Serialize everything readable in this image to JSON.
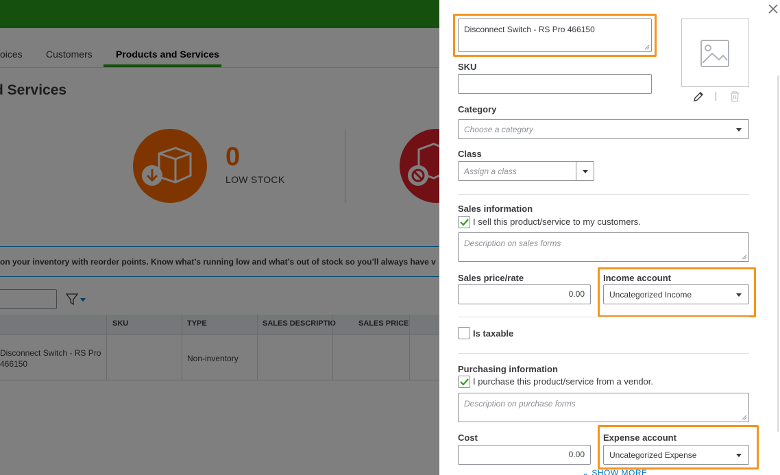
{
  "background": {
    "tabs": [
      "oices",
      "Customers",
      "Products and Services"
    ],
    "active_tab": "Products and Services",
    "page_title": "d Services",
    "low_stock": {
      "count": "0",
      "label": "LOW STOCK"
    },
    "banner_text": "on your inventory with reorder points. Know what’s running low and what’s out of stock so you’ll always have v",
    "table": {
      "headers": [
        "SKU",
        "TYPE",
        "SALES DESCRIPTIO",
        "SALES PRICE"
      ],
      "row": {
        "name_line1": "Disconnect Switch - RS Pro",
        "name_line2": "466150",
        "type": "Non-inventory"
      }
    }
  },
  "panel": {
    "name_value": "Disconnect Switch - RS Pro 466150",
    "sku_label": "SKU",
    "category_label": "Category",
    "category_placeholder": "Choose a category",
    "class_label": "Class",
    "class_placeholder": "Assign a class",
    "sales": {
      "section_label": "Sales information",
      "checkbox_text": "I sell this product/service to my customers.",
      "description_placeholder": "Description on sales forms",
      "price_label": "Sales price/rate",
      "price_value": "0.00",
      "income_label": "Income account",
      "income_value": "Uncategorized Income"
    },
    "taxable_label": "Is taxable",
    "purchasing": {
      "section_label": "Purchasing information",
      "checkbox_text": "I purchase this product/service from a vendor.",
      "description_placeholder": "Description on purchase forms",
      "cost_label": "Cost",
      "cost_value": "0.00",
      "expense_label": "Expense account",
      "expense_value": "Uncategorized Expense"
    },
    "show_more": "SHOW MORE"
  },
  "colors": {
    "brand_green": "#2ca01c",
    "highlight_orange": "#f7941d",
    "low_stock_orange": "#ff6a00",
    "out_of_stock_red": "#e3202a",
    "link_blue": "#0077c5"
  }
}
